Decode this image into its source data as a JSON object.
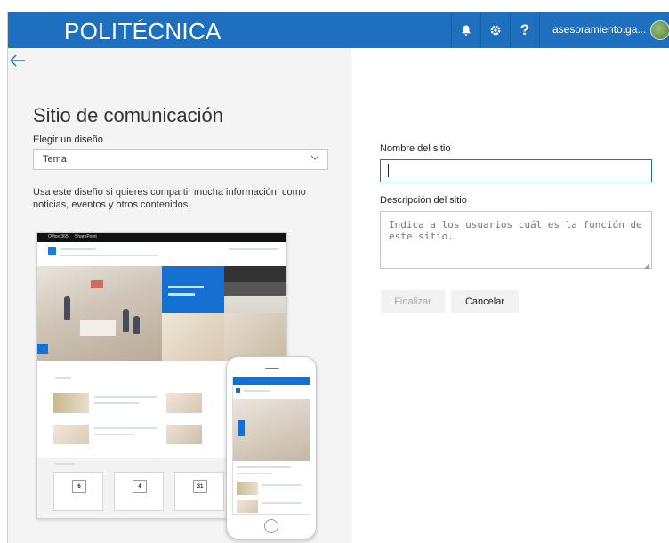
{
  "header": {
    "brand": "POLITÉCNICA",
    "user": "asesoramiento.ga...",
    "icons": [
      "bell-icon",
      "gear-icon",
      "help-icon"
    ],
    "help_glyph": "?",
    "accent_color": "#1f6fbf"
  },
  "left_panel": {
    "back_icon": "arrow-left-icon",
    "title": "Sitio de comunicación",
    "design_label": "Elegir un diseño",
    "design_value": "Tema",
    "description": "Usa este diseño si quieres compartir mucha información, como noticias, eventos y otros contenidos.",
    "preview": {
      "bar_items": [
        "Office 365",
        "SharePoint"
      ],
      "calendar_days": [
        "6",
        "4",
        "31"
      ]
    }
  },
  "form": {
    "site_name_label": "Nombre del sitio",
    "site_name_value": "",
    "site_description_label": "Descripción del sitio",
    "site_description_placeholder": "Indica a los usuarios cuál es la función de este sitio.",
    "finish_label": "Finalizar",
    "cancel_label": "Cancelar"
  }
}
